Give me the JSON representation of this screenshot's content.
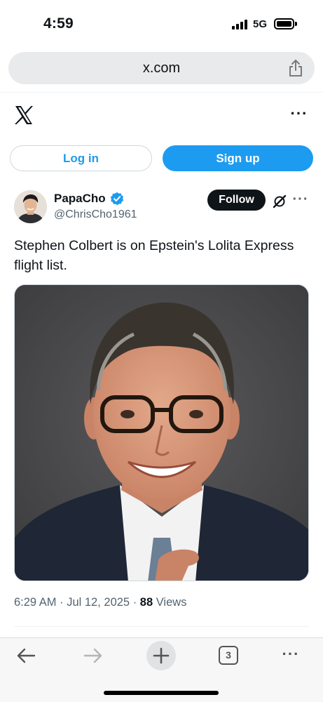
{
  "status_bar": {
    "time": "4:59",
    "network": "5G",
    "battery_level": 1.0
  },
  "browser": {
    "url": "x.com",
    "tab_count": "3",
    "icons": [
      "share-icon",
      "back-arrow-icon",
      "forward-arrow-icon",
      "new-tab-icon",
      "tabs-icon",
      "more-icon"
    ]
  },
  "header": {
    "more": "···"
  },
  "auth": {
    "login_label": "Log in",
    "signup_label": "Sign up"
  },
  "post": {
    "display_name": "PapaCho",
    "handle": "@ChrisCho1961",
    "follow_label": "Follow",
    "more": "···",
    "text": "Stephen Colbert is on Epstein's Lolita Express flight list.",
    "timestamp": "6:29 AM · Jul 12, 2025 · ",
    "views_count": "88",
    "views_label": " Views"
  },
  "colors": {
    "accent": "#1d9bf0",
    "text": "#0f1419",
    "secondary": "#536471",
    "follow_bg": "#0f1419"
  }
}
